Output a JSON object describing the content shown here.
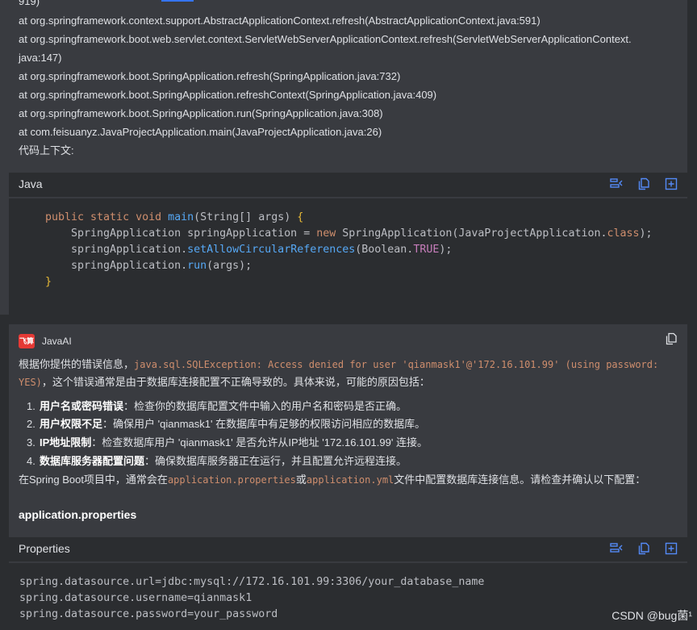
{
  "trace": {
    "partial_top": "919)",
    "lines": [
      "at org.springframework.context.support.AbstractApplicationContext.refresh(AbstractApplicationContext.java:591)",
      "at org.springframework.boot.web.servlet.context.ServletWebServerApplicationContext.refresh(ServletWebServerApplicationContext.",
      "java:147)",
      "at org.springframework.boot.SpringApplication.refresh(SpringApplication.java:732)",
      "at org.springframework.boot.SpringApplication.refreshContext(SpringApplication.java:409)",
      "at org.springframework.boot.SpringApplication.run(SpringApplication.java:308)",
      "at com.feisuanyz.JavaProjectApplication.main(JavaProjectApplication.java:26)",
      "代码上下文:"
    ]
  },
  "java_block": {
    "language": "Java",
    "code": {
      "l1_kw": "public static void ",
      "l1_fn": "main",
      "l1_rest": "(String[] args) ",
      "l1_brace": "{",
      "l2_a": "SpringApplication springApplication = ",
      "l2_kw": "new ",
      "l2_b": "SpringApplication(JavaProjectApplication.",
      "l2_kw2": "class",
      "l2_c": ");",
      "l3_a": "springApplication.",
      "l3_fn": "setAllowCircularReferences",
      "l3_b": "(Boolean.",
      "l3_field": "TRUE",
      "l3_c": ");",
      "l4_a": "springApplication.",
      "l4_fn": "run",
      "l4_b": "(args);",
      "l5_brace": "}"
    }
  },
  "ai": {
    "avatar_text": "飞算",
    "name": "JavaAI",
    "intro_a": "根据你提供的错误信息，",
    "intro_code": "java.sql.SQLException: Access denied for user 'qianmask1'@'172.16.101.99' (using password:",
    "intro_code2": "YES)",
    "intro_b": "，这个错误通常是由于数据库连接配置不正确导致的。具体来说，可能的原因包括：",
    "items": [
      {
        "num": "1.",
        "title": "用户名或密码错误",
        "text": "：检查你的数据库配置文件中输入的用户名和密码是否正确。"
      },
      {
        "num": "2.",
        "title": "用户权限不足",
        "text": "：确保用户 'qianmask1' 在数据库中有足够的权限访问相应的数据库。"
      },
      {
        "num": "3.",
        "title": "IP地址限制",
        "text": "：检查数据库用户 'qianmask1' 是否允许从IP地址 '172.16.101.99' 连接。"
      },
      {
        "num": "4.",
        "title": "数据库服务器配置问题",
        "text": "：确保数据库服务器正在运行，并且配置允许远程连接。"
      }
    ],
    "outro_a": "在Spring Boot项目中，通常会在",
    "outro_code1": "application.properties",
    "outro_or": "或",
    "outro_code2": "application.yml",
    "outro_b": "文件中配置数据库连接信息。请检查并确认以下配置：",
    "section_title": "application.properties"
  },
  "props_block": {
    "language": "Properties",
    "lines": [
      "spring.datasource.url=jdbc:mysql://172.16.101.99:3306/your_database_name",
      "spring.datasource.username=qianmask1",
      "spring.datasource.password=your_password"
    ]
  },
  "watermark": "CSDN @bug菌¹",
  "colors": {
    "accent": "#3574f0",
    "keyword": "#cf8e6d",
    "function": "#56a8f5",
    "avatar": "#e53935"
  },
  "icons": [
    "insert-icon",
    "copy-icon",
    "new-file-icon",
    "copy-icon"
  ]
}
